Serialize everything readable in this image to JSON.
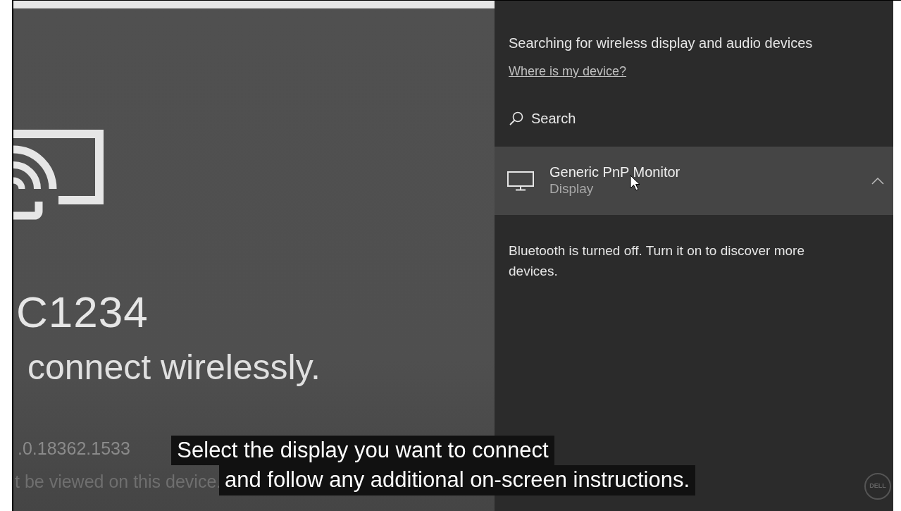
{
  "preview": {
    "code": "C1234",
    "instruction": "connect wirelessly.",
    "version": ".0.18362.1533",
    "note": "t be viewed on this device."
  },
  "connect_panel": {
    "status": "Searching for wireless display and audio devices",
    "help_link": "Where is my device?",
    "search": {
      "label": "Search"
    },
    "devices": [
      {
        "name": "Generic PnP Monitor",
        "type": "Display",
        "expanded": true,
        "selected": true
      }
    ],
    "bluetooth_note": "Bluetooth is turned off. Turn it on to discover more devices."
  },
  "captions": [
    "Select the display you want to connect",
    "and follow any additional on-screen instructions."
  ],
  "logo": {
    "text": "DELL"
  }
}
